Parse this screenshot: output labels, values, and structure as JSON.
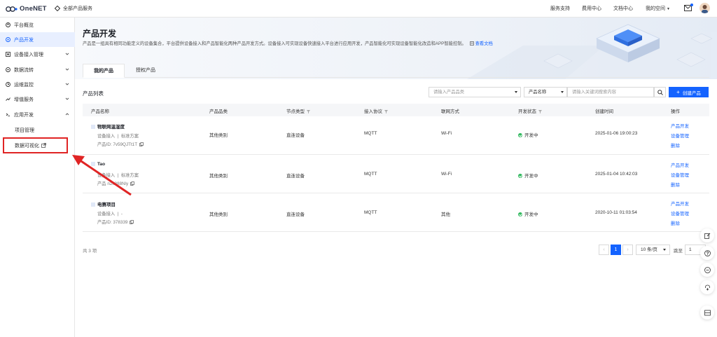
{
  "header": {
    "logo_text": "OneNET",
    "all_products": "全部产品服务",
    "nav": [
      "服务支持",
      "费用中心",
      "文档中心",
      "我的空间"
    ]
  },
  "sidebar": {
    "items": [
      {
        "label": "平台概览",
        "icon": "home-icon"
      },
      {
        "label": "产品开发",
        "icon": "product-icon",
        "active": true
      },
      {
        "label": "设备接入管理",
        "icon": "device-icon"
      },
      {
        "label": "数据流转",
        "icon": "flow-icon"
      },
      {
        "label": "运维监控",
        "icon": "monitor-icon"
      },
      {
        "label": "增值服务",
        "icon": "value-icon"
      },
      {
        "label": "应用开发",
        "icon": "app-icon"
      }
    ],
    "subitems": [
      "项目管理",
      "数据可视化"
    ]
  },
  "banner": {
    "title": "产品开发",
    "desc": "产品是一组具有相同功能定义的设备集合，平台提供设备接入和产品智能化两种产品开发方式。设备接入可实现设备快速接入平台进行应用开发，产品智能化可实现设备智能化改造和APP智能控制。",
    "doc_link": "查看文档"
  },
  "tabs": [
    "我的产品",
    "授权产品"
  ],
  "list": {
    "title": "产品列表",
    "category_placeholder": "请输入产品品类",
    "field_select": "产品名称",
    "keyword_placeholder": "请输入关键词搜索内容",
    "create_label": "创建产品"
  },
  "table": {
    "headers": [
      "产品名称",
      "产品品类",
      "节点类型",
      "接入协议",
      "联网方式",
      "开发状态",
      "创建时间",
      "操作"
    ],
    "rows": [
      {
        "name": "物联网温湿度",
        "access": "设备接入",
        "scheme": "标准方案",
        "pid_label": "产品ID:",
        "pid": "7v59QJTt1T",
        "category": "其他类别",
        "node": "直连设备",
        "protocol": "MQTT",
        "network": "Wi-Fi",
        "status": "开发中",
        "created": "2025-01-06 19:00:23"
      },
      {
        "name": "Tao",
        "access": "设备接入",
        "scheme": "标准方案",
        "pid_label": "产品",
        "pid": "n2k888Nly",
        "category": "其他类别",
        "node": "直连设备",
        "protocol": "MQTT",
        "network": "Wi-Fi",
        "status": "开发中",
        "created": "2025-01-04 10:42:03"
      },
      {
        "name": "电赛项目",
        "access": "设备接入",
        "scheme": "-",
        "pid_label": "产品ID:",
        "pid": "378339",
        "category": "其他类别",
        "node": "直连设备",
        "protocol": "MQTT",
        "network": "其他",
        "status": "开发中",
        "created": "2020-10-11 01:03:54"
      }
    ],
    "ops": [
      "产品开发",
      "设备管理",
      "删除"
    ]
  },
  "pagination": {
    "total": "共 3 项",
    "current": "1",
    "prev": "‹",
    "next": "›",
    "page_size": "10 条/页",
    "jump_label": "跳至",
    "jump_value": "1"
  },
  "colors": {
    "primary": "#1463ff",
    "annotation": "#e02424",
    "success": "#2eb85c"
  }
}
